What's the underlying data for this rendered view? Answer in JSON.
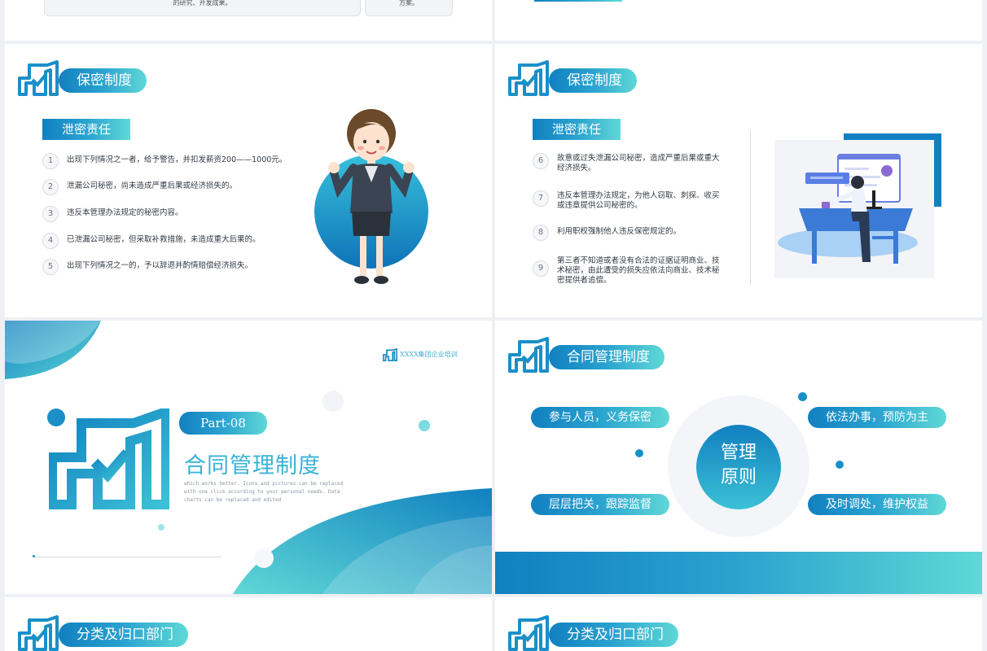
{
  "top_strip": {
    "left_box_text": "的研究、开发成果。",
    "right_box_text": "方案。"
  },
  "slide1": {
    "title": "保密制度",
    "subtitle": "泄密责任",
    "items": [
      {
        "num": "1",
        "text": "出现下列情况之一者，给予警告，并扣发薪资200——1000元。"
      },
      {
        "num": "2",
        "text": "泄漏公司秘密，尚未造成严重后果或经济损失的。"
      },
      {
        "num": "3",
        "text": "违反本管理办法规定的秘密内容。"
      },
      {
        "num": "4",
        "text": "已泄漏公司秘密，但采取补救措施，未造成重大后果的。"
      },
      {
        "num": "5",
        "text": "出现下列情况之一的，予以辞退并酌情赔偿经济损失。"
      }
    ]
  },
  "slide2": {
    "title": "保密制度",
    "subtitle": "泄密责任",
    "items": [
      {
        "num": "6",
        "line1": "故意或过失泄漏公司秘密，造成严重后果或重大",
        "line2": "经济损失。",
        "line3": ""
      },
      {
        "num": "7",
        "line1": "违反本管理办法规定，为他人窃取、刺探、收买",
        "line2": "或违章提供公司秘密的。",
        "line3": ""
      },
      {
        "num": "8",
        "line1": "利用职权强制他人违反保密规定的。",
        "line2": "",
        "line3": ""
      },
      {
        "num": "9",
        "line1": "第三者不知道或者没有合法的证据证明商业、技",
        "line2": "术秘密，由此遭受的损失应依法向商业、技术秘",
        "line3": "密提供者追偿。"
      }
    ]
  },
  "slide3": {
    "brand": "XXXX集团企业培训",
    "part": "Part-08",
    "heading": "合同管理制度",
    "desc1": "which works better. Icons and pictures can be replaced",
    "desc2": "with one click according to your personal needs. Data",
    "desc3": "charts can be replaced and edited"
  },
  "slide4": {
    "title": "合同管理制度",
    "center_line1": "管理",
    "center_line2": "原则",
    "pills": [
      "参与人员，义务保密",
      "依法办事，预防为主",
      "层层把关，跟踪监督",
      "及时调处，维护权益"
    ]
  },
  "slide5": {
    "title": "分类及归口部门"
  },
  "slide6": {
    "title": "分类及归口部门"
  },
  "colors": {
    "primary": "#1180c0",
    "accent": "#5fd8d6"
  }
}
